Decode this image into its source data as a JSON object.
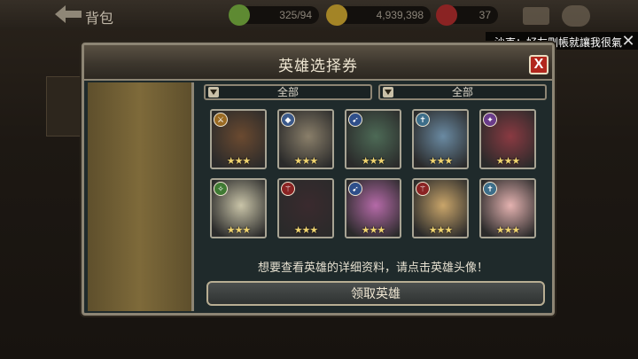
{
  "topbar": {
    "title": "背包",
    "stamina": "325/94",
    "gold": "4,939,398",
    "gems": "37"
  },
  "chat": {
    "message": "沙克：好友刪帳就讓我很氣"
  },
  "modal": {
    "title": "英雄选择券",
    "close_label": "X",
    "filters": [
      {
        "label": "全部"
      },
      {
        "label": "全部"
      }
    ],
    "hint": "想要查看英雄的详细资料，请点击英雄头像！",
    "claim_button": "领取英雄"
  },
  "heroes": [
    {
      "stars": "★★★",
      "class_icon": "sword-icon",
      "class_color": "#9a6a23",
      "color": "#6b4a30"
    },
    {
      "stars": "★★★",
      "class_icon": "shield-icon",
      "class_color": "#3c5a8a",
      "color": "#8a7f6a"
    },
    {
      "stars": "★★★",
      "class_icon": "gun-icon",
      "class_color": "#2f4f8a",
      "color": "#4d6a56"
    },
    {
      "stars": "★★★",
      "class_icon": "cross-icon",
      "class_color": "#3d6e8a",
      "color": "#6a8aa2"
    },
    {
      "stars": "★★★",
      "class_icon": "magic-icon",
      "class_color": "#6a3c8a",
      "color": "#8a3a42"
    },
    {
      "stars": "★★★",
      "class_icon": "leaf-icon",
      "class_color": "#3f7a33",
      "color": "#c9c4a8"
    },
    {
      "stars": "★★★",
      "class_icon": "staff-icon",
      "class_color": "#8a2323",
      "color": "#3a2a2e"
    },
    {
      "stars": "★★★",
      "class_icon": "gun-icon",
      "class_color": "#2f4f8a",
      "color": "#b56aa8"
    },
    {
      "stars": "★★★",
      "class_icon": "staff-icon",
      "class_color": "#8a2323",
      "color": "#c9a56a"
    },
    {
      "stars": "★★★",
      "class_icon": "cross-icon",
      "class_color": "#3d6e8a",
      "color": "#e4b2b0"
    }
  ]
}
